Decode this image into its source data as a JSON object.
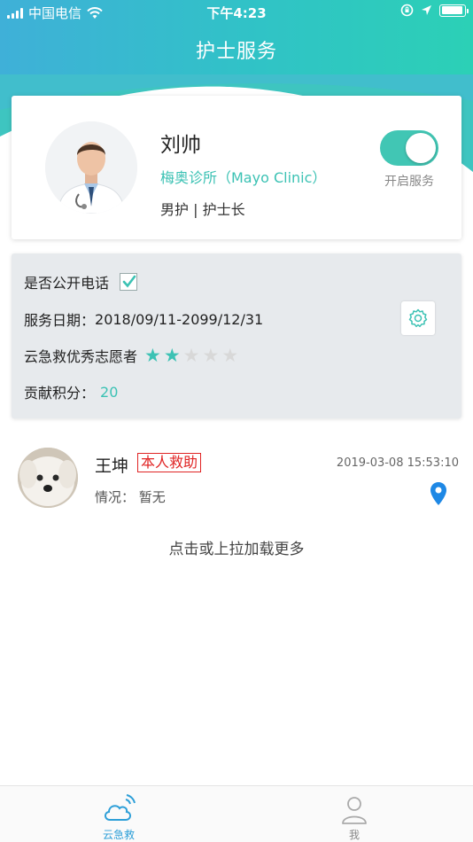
{
  "status_bar": {
    "carrier": "中国电信",
    "time": "下午4:23",
    "battery_level": 0.95
  },
  "nav": {
    "title": "护士服务"
  },
  "profile": {
    "name": "刘帅",
    "clinic": "梅奥诊所（Mayo Clinic）",
    "role": "男护 | 护士长",
    "service_toggle_label": "开启服务",
    "service_enabled": true
  },
  "info": {
    "public_phone_label": "是否公开电话",
    "public_phone_checked": true,
    "service_date_label": "服务日期：",
    "service_date_value": "2018/09/11-2099/12/31",
    "volunteer_label": "云急救优秀志愿者",
    "stars_filled": 2,
    "stars_total": 5,
    "score_label": "贡献积分：",
    "score_value": "20"
  },
  "records": [
    {
      "name": "王坤",
      "badge": "本人救助",
      "time": "2019-03-08 15:53:10",
      "status": "情况：  暂无"
    }
  ],
  "load_more": "点击或上拉加载更多",
  "tabbar": {
    "tabs": [
      {
        "label": "云急救",
        "active": true
      },
      {
        "label": "我",
        "active": false
      }
    ]
  },
  "colors": {
    "accent": "#3cc2b4",
    "header_start": "#3fb0d8",
    "header_end": "#2cd0b6",
    "badge_red": "#e02424",
    "tab_active": "#2d9fd8",
    "tab_inactive": "#999999"
  }
}
